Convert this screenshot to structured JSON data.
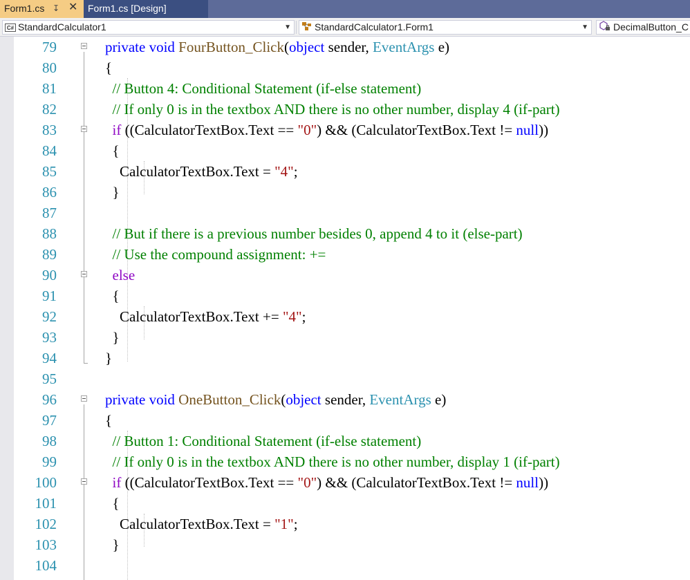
{
  "tabs": [
    {
      "label": "Form1.cs",
      "active": true
    },
    {
      "label": "Form1.cs [Design]",
      "active": false
    }
  ],
  "navbar": {
    "project": "StandardCalculator1",
    "type": "StandardCalculator1.Form1",
    "member": "DecimalButton_C",
    "icons": [
      "csharp-project-icon",
      "class-icon",
      "method-icon"
    ]
  },
  "colors": {
    "keyword": "#0000ff",
    "control_keyword": "#8f08c4",
    "type": "#2b91af",
    "method": "#74531f",
    "string": "#a31515",
    "comment": "#008000",
    "line_number": "#2b91af",
    "tab_active": "#f5cc84",
    "tab_inactive": "#3b4f81",
    "tabstrip": "#5d6b99"
  },
  "editor": {
    "lines": [
      {
        "n": "79",
        "fold": true,
        "tokens": [
          [
            "pl",
            "    "
          ],
          [
            "kw",
            "private"
          ],
          [
            "pl",
            " "
          ],
          [
            "kw",
            "void"
          ],
          [
            "pl",
            " "
          ],
          [
            "mth",
            "FourButton_Click"
          ],
          [
            "pl",
            "("
          ],
          [
            "kw",
            "object"
          ],
          [
            "pl",
            " sender, "
          ],
          [
            "typ",
            "EventArgs"
          ],
          [
            "pl",
            " e)"
          ]
        ]
      },
      {
        "n": "80",
        "fold": false,
        "tokens": [
          [
            "pl",
            "    {"
          ]
        ]
      },
      {
        "n": "81",
        "fold": false,
        "tokens": [
          [
            "pl",
            "      "
          ],
          [
            "cmt",
            "// Button 4: Conditional Statement (if-else statement)"
          ]
        ]
      },
      {
        "n": "82",
        "fold": false,
        "tokens": [
          [
            "pl",
            "      "
          ],
          [
            "cmt",
            "// If only 0 is in the textbox AND there is no other number, display 4 (if-part)"
          ]
        ]
      },
      {
        "n": "83",
        "fold": true,
        "tokens": [
          [
            "pl",
            "      "
          ],
          [
            "ctl",
            "if"
          ],
          [
            "pl",
            " ((CalculatorTextBox.Text == "
          ],
          [
            "str",
            "\"0\""
          ],
          [
            "pl",
            ") && (CalculatorTextBox.Text != "
          ],
          [
            "kw",
            "null"
          ],
          [
            "pl",
            "))"
          ]
        ]
      },
      {
        "n": "84",
        "fold": false,
        "tokens": [
          [
            "pl",
            "      {"
          ]
        ]
      },
      {
        "n": "85",
        "fold": false,
        "tokens": [
          [
            "pl",
            "        CalculatorTextBox.Text = "
          ],
          [
            "str",
            "\"4\""
          ],
          [
            "pl",
            ";"
          ]
        ]
      },
      {
        "n": "86",
        "fold": false,
        "tokens": [
          [
            "pl",
            "      }"
          ]
        ]
      },
      {
        "n": "87",
        "fold": false,
        "tokens": []
      },
      {
        "n": "88",
        "fold": false,
        "tokens": [
          [
            "pl",
            "      "
          ],
          [
            "cmt",
            "// But if there is a previous number besides 0, append 4 to it (else-part)"
          ]
        ]
      },
      {
        "n": "89",
        "fold": false,
        "tokens": [
          [
            "pl",
            "      "
          ],
          [
            "cmt",
            "// Use the compound assignment: +="
          ]
        ]
      },
      {
        "n": "90",
        "fold": true,
        "tokens": [
          [
            "pl",
            "      "
          ],
          [
            "ctl",
            "else"
          ]
        ]
      },
      {
        "n": "91",
        "fold": false,
        "tokens": [
          [
            "pl",
            "      {"
          ]
        ]
      },
      {
        "n": "92",
        "fold": false,
        "tokens": [
          [
            "pl",
            "        CalculatorTextBox.Text += "
          ],
          [
            "str",
            "\"4\""
          ],
          [
            "pl",
            ";"
          ]
        ]
      },
      {
        "n": "93",
        "fold": false,
        "tokens": [
          [
            "pl",
            "      }"
          ]
        ]
      },
      {
        "n": "94",
        "fold": false,
        "tokens": [
          [
            "pl",
            "    }"
          ]
        ]
      },
      {
        "n": "95",
        "fold": false,
        "tokens": []
      },
      {
        "n": "96",
        "fold": true,
        "tokens": [
          [
            "pl",
            "    "
          ],
          [
            "kw",
            "private"
          ],
          [
            "pl",
            " "
          ],
          [
            "kw",
            "void"
          ],
          [
            "pl",
            " "
          ],
          [
            "mth",
            "OneButton_Click"
          ],
          [
            "pl",
            "("
          ],
          [
            "kw",
            "object"
          ],
          [
            "pl",
            " sender, "
          ],
          [
            "typ",
            "EventArgs"
          ],
          [
            "pl",
            " e)"
          ]
        ]
      },
      {
        "n": "97",
        "fold": false,
        "tokens": [
          [
            "pl",
            "    {"
          ]
        ]
      },
      {
        "n": "98",
        "fold": false,
        "tokens": [
          [
            "pl",
            "      "
          ],
          [
            "cmt",
            "// Button 1: Conditional Statement (if-else statement)"
          ]
        ]
      },
      {
        "n": "99",
        "fold": false,
        "tokens": [
          [
            "pl",
            "      "
          ],
          [
            "cmt",
            "// If only 0 is in the textbox AND there is no other number, display 1 (if-part)"
          ]
        ]
      },
      {
        "n": "100",
        "fold": true,
        "tokens": [
          [
            "pl",
            "      "
          ],
          [
            "ctl",
            "if"
          ],
          [
            "pl",
            " ((CalculatorTextBox.Text == "
          ],
          [
            "str",
            "\"0\""
          ],
          [
            "pl",
            ") && (CalculatorTextBox.Text != "
          ],
          [
            "kw",
            "null"
          ],
          [
            "pl",
            "))"
          ]
        ]
      },
      {
        "n": "101",
        "fold": false,
        "tokens": [
          [
            "pl",
            "      {"
          ]
        ]
      },
      {
        "n": "102",
        "fold": false,
        "tokens": [
          [
            "pl",
            "        CalculatorTextBox.Text = "
          ],
          [
            "str",
            "\"1\""
          ],
          [
            "pl",
            ";"
          ]
        ]
      },
      {
        "n": "103",
        "fold": false,
        "tokens": [
          [
            "pl",
            "      }"
          ]
        ]
      },
      {
        "n": "104",
        "fold": false,
        "tokens": []
      }
    ]
  }
}
